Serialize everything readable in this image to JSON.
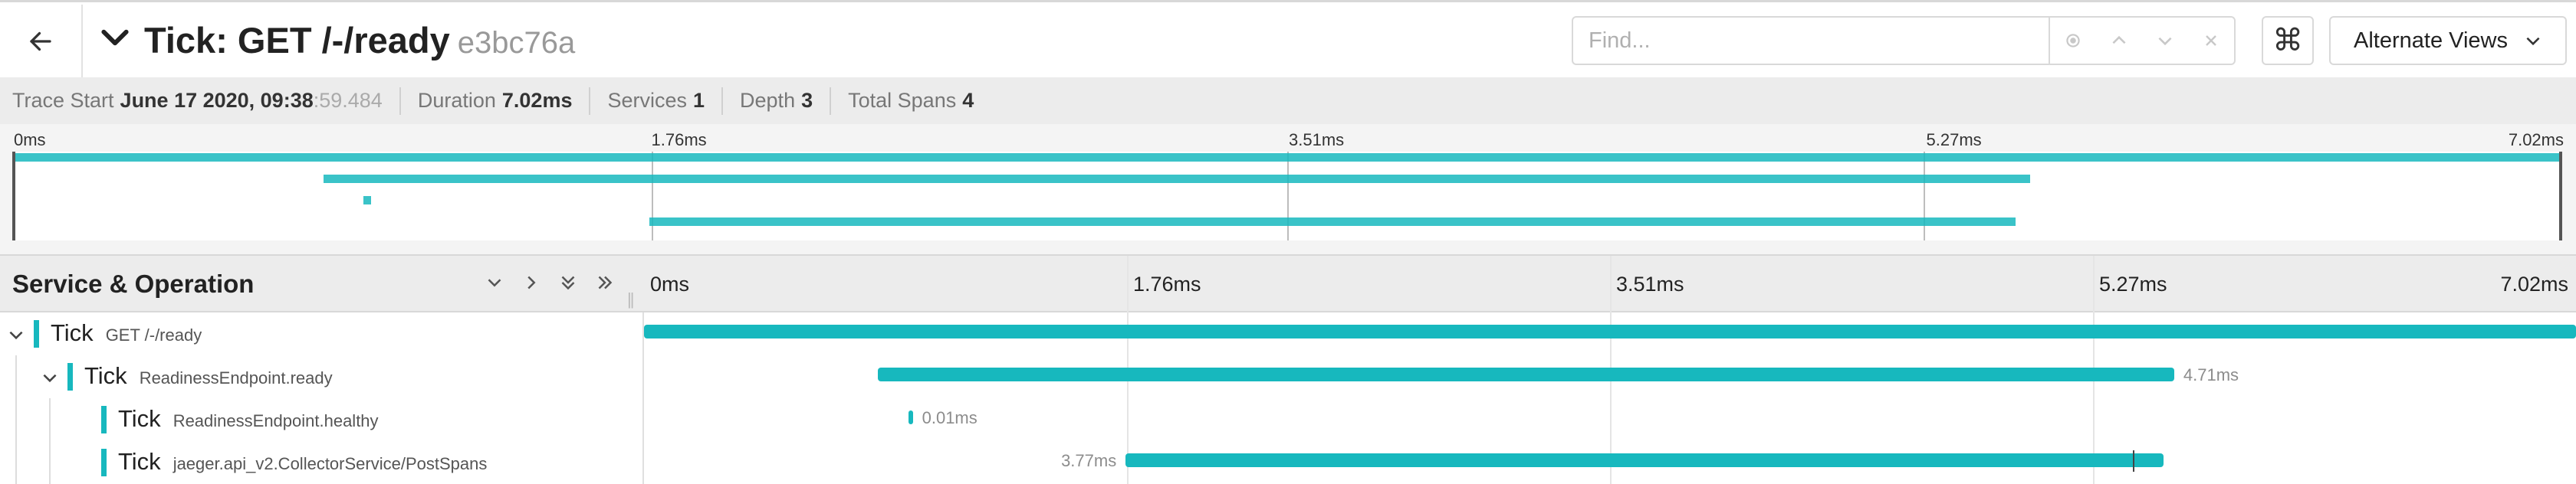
{
  "header": {
    "title": "Tick: GET /-/ready",
    "trace_id": "e3bc76a",
    "find_placeholder": "Find...",
    "cmd_symbol": "⌘",
    "alternate_views_label": "Alternate Views"
  },
  "meta": {
    "trace_start_label": "Trace Start",
    "trace_start_date": "June 17 2020, 09:38",
    "trace_start_ms": ":59.484",
    "duration_label": "Duration",
    "duration_value": "7.02ms",
    "services_label": "Services",
    "services_value": "1",
    "depth_label": "Depth",
    "depth_value": "3",
    "total_spans_label": "Total Spans",
    "total_spans_value": "4"
  },
  "minimap": {
    "ticks": [
      "0ms",
      "1.76ms",
      "3.51ms",
      "5.27ms",
      "7.02ms"
    ]
  },
  "timeline": {
    "column_title": "Service & Operation",
    "ticks": [
      "0ms",
      "1.76ms",
      "3.51ms",
      "5.27ms",
      "7.02ms"
    ],
    "total_ms": 7.02
  },
  "spans": [
    {
      "service": "Tick",
      "operation": "GET /-/ready",
      "depth": 0,
      "start_ms": 0,
      "duration_ms": 7.02,
      "label": "",
      "expanded": true,
      "has_children": true
    },
    {
      "service": "Tick",
      "operation": "ReadinessEndpoint.ready",
      "depth": 1,
      "start_ms": 0.85,
      "duration_ms": 4.71,
      "label": "4.71ms",
      "expanded": true,
      "has_children": true
    },
    {
      "service": "Tick",
      "operation": "ReadinessEndpoint.healthy",
      "depth": 2,
      "start_ms": 0.96,
      "duration_ms": 0.01,
      "label": "0.01ms",
      "expanded": false,
      "has_children": false
    },
    {
      "service": "Tick",
      "operation": "jaeger.api_v2.CollectorService/PostSpans",
      "depth": 2,
      "start_ms": 1.75,
      "duration_ms": 3.77,
      "label": "3.77ms",
      "expanded": false,
      "has_children": false
    }
  ],
  "colors": {
    "span": "#17b8be",
    "header_bg": "#ececec"
  }
}
